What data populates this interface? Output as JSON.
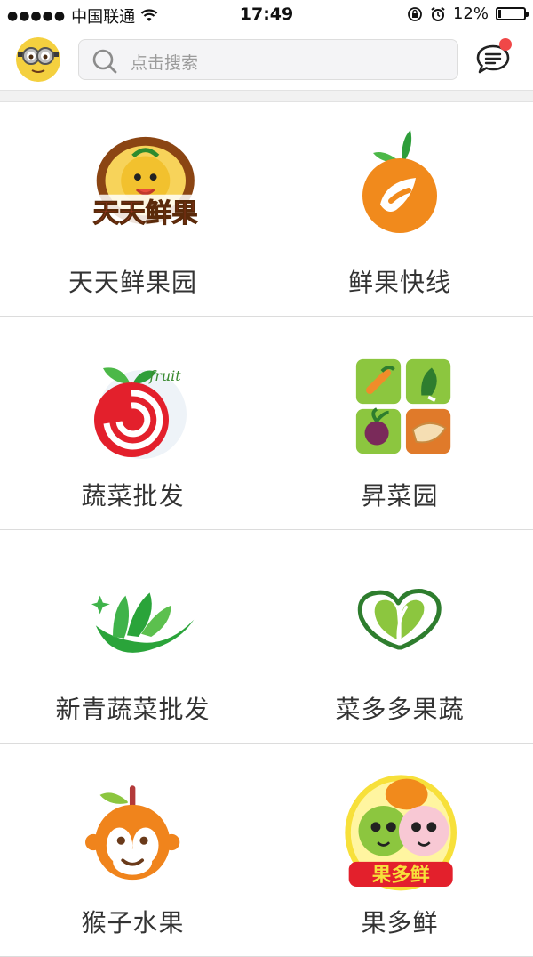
{
  "status_bar": {
    "signal": "●●●●●",
    "carrier": "中国联通",
    "time": "17:49",
    "battery_percent": "12%",
    "battery_level": 0.12
  },
  "header": {
    "search_placeholder": "点击搜索",
    "notification_dot_color": "#f04848"
  },
  "stores": [
    {
      "name": "天天鲜果园",
      "logo": "tiantian-fruit-logo",
      "logo_text": "天天鲜果"
    },
    {
      "name": "鲜果快线",
      "logo": "orange-fruit-logo"
    },
    {
      "name": "蔬菜批发",
      "logo": "red-apple-logo",
      "logo_text": "fruit"
    },
    {
      "name": "昇菜园",
      "logo": "vegetable-grid-logo"
    },
    {
      "name": "新青蔬菜批发",
      "logo": "green-leaves-logo"
    },
    {
      "name": "菜多多果蔬",
      "logo": "green-heart-leaf-logo"
    },
    {
      "name": "猴子水果",
      "logo": "monkey-orange-logo"
    },
    {
      "name": "果多鲜",
      "logo": "fruit-characters-logo",
      "logo_text": "果多鲜"
    }
  ]
}
